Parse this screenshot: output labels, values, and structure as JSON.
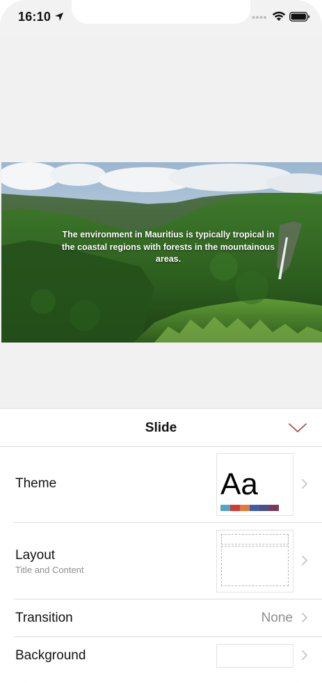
{
  "status_bar": {
    "time": "16:10",
    "icons": [
      "location-arrow-icon",
      "signal-dots-icon",
      "wifi-icon",
      "battery-icon"
    ]
  },
  "slide": {
    "caption": "The environment in Mauritius is typically tropical in the coastal regions with forests in the mountainous areas.",
    "image": "mountain-forest-waterfall-photo"
  },
  "sheet": {
    "title": "Slide",
    "accent_color": "#b04a4a",
    "rows": [
      {
        "label": "Theme",
        "thumb_text": "Aa",
        "swatches": [
          "#4fa8c2",
          "#d03b35",
          "#e07b39",
          "#3d5fa6",
          "#4d4f86",
          "#7a3a55"
        ]
      },
      {
        "label": "Layout",
        "sublabel": "Title and Content"
      },
      {
        "label": "Transition",
        "value": "None"
      },
      {
        "label": "Background"
      }
    ]
  }
}
